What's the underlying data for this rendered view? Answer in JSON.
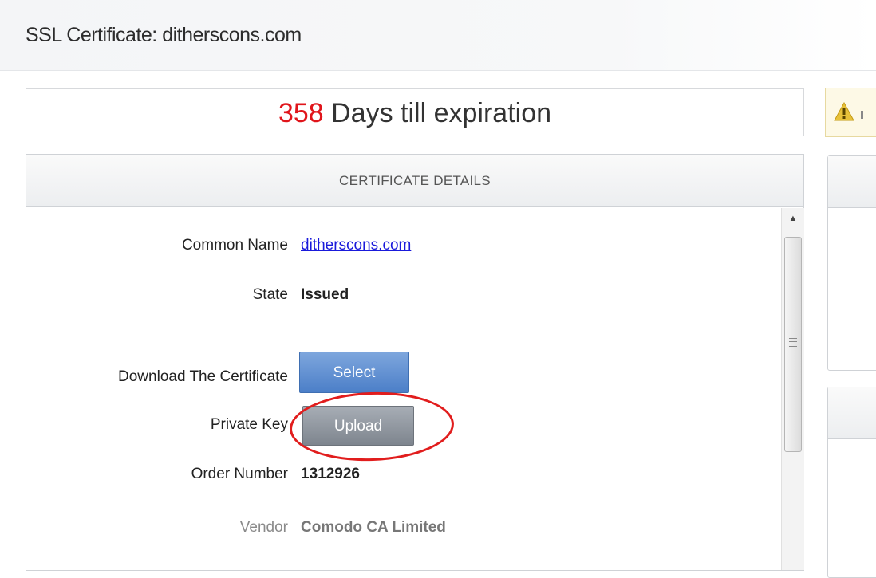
{
  "header": {
    "title": "SSL Certificate: ditherscons.com"
  },
  "expiration": {
    "days": "358",
    "suffix": " Days till expiration"
  },
  "details_panel": {
    "title": "CERTIFICATE DETAILS",
    "rows": [
      {
        "label": "Common Name",
        "value": "ditherscons.com"
      },
      {
        "label": "State",
        "value": "Issued"
      },
      {
        "label": "Download The Certificate",
        "button": "Select"
      },
      {
        "label": "Private Key",
        "button": "Upload"
      },
      {
        "label": "Order Number",
        "value": "1312926"
      },
      {
        "label": "Vendor",
        "value": "Comodo CA Limited"
      }
    ]
  },
  "icons": {
    "warning": "warning-icon",
    "scroll_up": "chevron-up-icon",
    "scroll_grip": "grip-icon"
  },
  "colors": {
    "expiry_days": "#e0151b",
    "link": "#1a1adb",
    "select_button": "#4c7fc8",
    "upload_button": "#7e858e",
    "annotation": "#e11d1d"
  }
}
